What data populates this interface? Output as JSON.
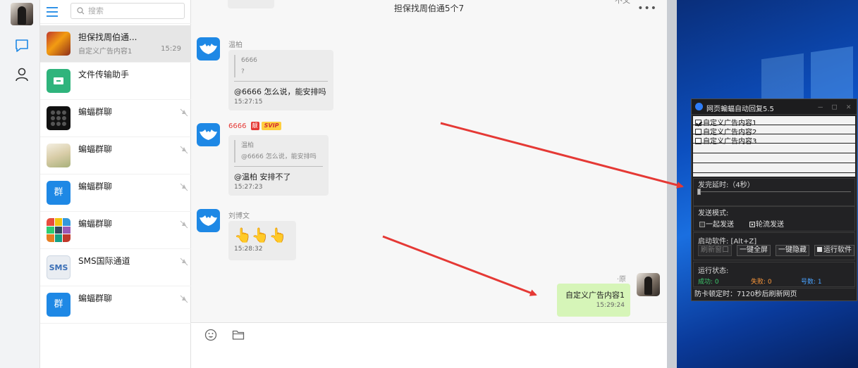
{
  "search": {
    "placeholder": "搜索"
  },
  "conversations": [
    {
      "name": "担保找周伯通...",
      "preview": "自定义广告内容1",
      "time": "15:29",
      "avatar": "group-photo-avatar",
      "active": true
    },
    {
      "name": "文件传输助手",
      "preview": "",
      "time": "",
      "avatar": "folder-icon"
    },
    {
      "name": "蝙蝠群聊",
      "preview": "",
      "time": "",
      "avatar": "dots-avatar",
      "muted": true
    },
    {
      "name": "蝙蝠群聊",
      "preview": "",
      "time": "",
      "avatar": "person-avatar",
      "muted": true
    },
    {
      "name": "蝙蝠群聊",
      "preview": "",
      "time": "",
      "avatar": "group-icon",
      "group_glyph": "群",
      "muted": true
    },
    {
      "name": "蝙蝠群聊",
      "preview": "",
      "time": "",
      "avatar": "collage-avatar",
      "muted": true
    },
    {
      "name": "SMS国际通道",
      "preview": "",
      "time": "",
      "avatar": "sms-icon",
      "sms_text": "SMS",
      "muted": true
    },
    {
      "name": "蝙蝠群聊",
      "preview": "",
      "time": "",
      "avatar": "group-icon",
      "group_glyph": "群",
      "muted": true
    }
  ],
  "chat": {
    "title": "担保找周伯通5个7",
    "more": "•••",
    "header_fragment": "不文",
    "messages": [
      {
        "sender": "温柏",
        "quote_name": "6666",
        "quote_text": "?",
        "text": "@6666 怎么说，能安排吗",
        "time": "15:27:15"
      },
      {
        "sender": "6666",
        "badge_red": "靓",
        "badge_svip": "SVIP",
        "quote_name": "温柏",
        "quote_text": "@6666 怎么说，能安排吗",
        "text": "@温柏 安排不了",
        "time": "15:27:23"
      },
      {
        "sender": "刘博文",
        "emoji": "👆👆👆",
        "time": "15:28:32"
      }
    ],
    "my_message": {
      "name": "·原",
      "text": "自定义广告内容1",
      "time": "15:29:24"
    }
  },
  "tool": {
    "title": "网页蝙蝠自动回复5.5",
    "ctrls": [
      "—",
      "□",
      "✕"
    ],
    "items": [
      {
        "label": "自定义广告内容1",
        "checked": true
      },
      {
        "label": "自定义广告内容2",
        "checked": false
      },
      {
        "label": "自定义广告内容3",
        "checked": false
      }
    ],
    "delay_label": "发完延时:（4秒）",
    "delay_value": 4,
    "mode_label": "发送模式:",
    "mode_options": [
      "一起发送",
      "轮流发送"
    ],
    "mode_selected": "轮流发送",
    "start_label": "启动软件: [Alt+Z]",
    "buttons": [
      "刷新窗口",
      "一键全屏",
      "一键隐藏",
      "运行软件"
    ],
    "status_label": "运行状态:",
    "success_label": "成功: 0",
    "fail_label": "失败: 0",
    "count_label": "号数: 1",
    "footer": "防卡顿定时：7120秒后刷新网页"
  },
  "colors": {
    "bat_blue": "#1e88e5",
    "accent_green": "#d6f5b8",
    "success": "#3ec96c",
    "fail": "#ff9a3c",
    "count": "#4aa3ff",
    "arrow": "#e53935"
  }
}
